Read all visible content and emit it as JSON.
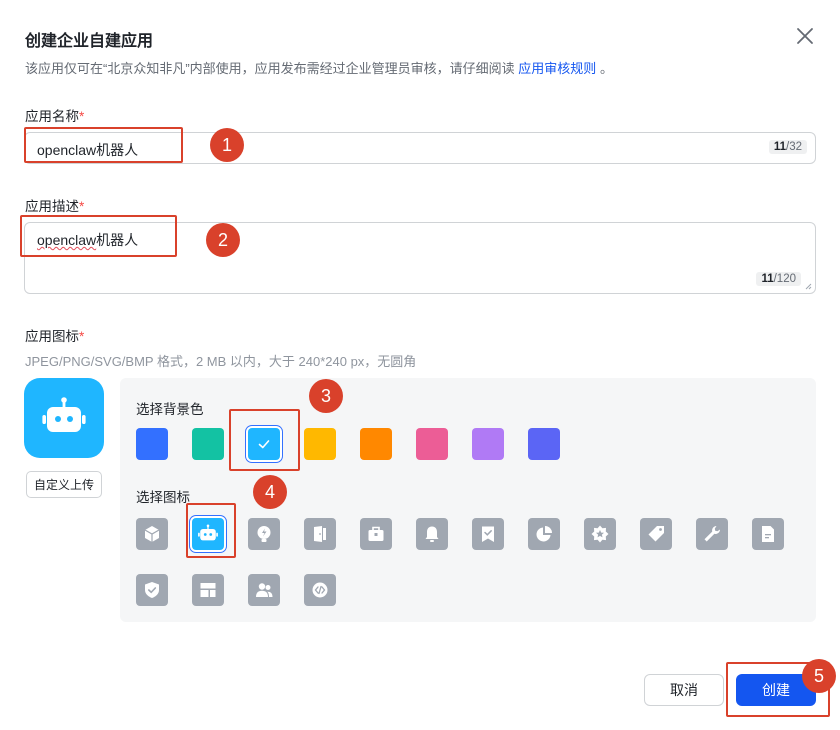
{
  "dialog": {
    "title": "创建企业自建应用",
    "subtitle": "该应用仅可在“北京众知非凡”内部使用，应用发布需经过企业管理员审核，请仔细阅读",
    "rules_link": "应用审核规则",
    "subtitle_end": "。"
  },
  "name_field": {
    "label": "应用名称",
    "required_mark": "*",
    "value": "openclaw机器人",
    "count": "11",
    "max": "/32"
  },
  "desc_field": {
    "label": "应用描述",
    "required_mark": "*",
    "value_underlined": "openclaw",
    "value_rest": "机器人",
    "count": "11",
    "max": "/120"
  },
  "icon_field": {
    "label": "应用图标",
    "required_mark": "*",
    "hint": "JPEG/PNG/SVG/BMP 格式，2 MB 以内，大于 240*240 px，无圆角",
    "upload_label": "自定义上传",
    "bg_label": "选择背景色",
    "icon_label": "选择图标",
    "preview_color": "#1fb6ff",
    "bg_colors": [
      "#3370ff",
      "#13c2a3",
      "#1fb6ff",
      "#ffb800",
      "#ff8800",
      "#ec5d96",
      "#b07af5",
      "#5b65f5"
    ],
    "selected_bg_index": 2,
    "icons": [
      "cube-icon",
      "robot-icon",
      "lightning-bulb-icon",
      "door-icon",
      "briefcase-icon",
      "bell-icon",
      "bookmark-check-icon",
      "pie-chart-icon",
      "star-badge-icon",
      "tag-icon",
      "wrench-icon",
      "document-icon",
      "shield-check-icon",
      "layout-icon",
      "users-icon",
      "code-icon"
    ],
    "selected_icon_index": 1
  },
  "footer": {
    "cancel_label": "取消",
    "create_label": "创建"
  },
  "annotations": {
    "color": "#d9412b",
    "steps": [
      "1",
      "2",
      "3",
      "4",
      "5"
    ]
  }
}
